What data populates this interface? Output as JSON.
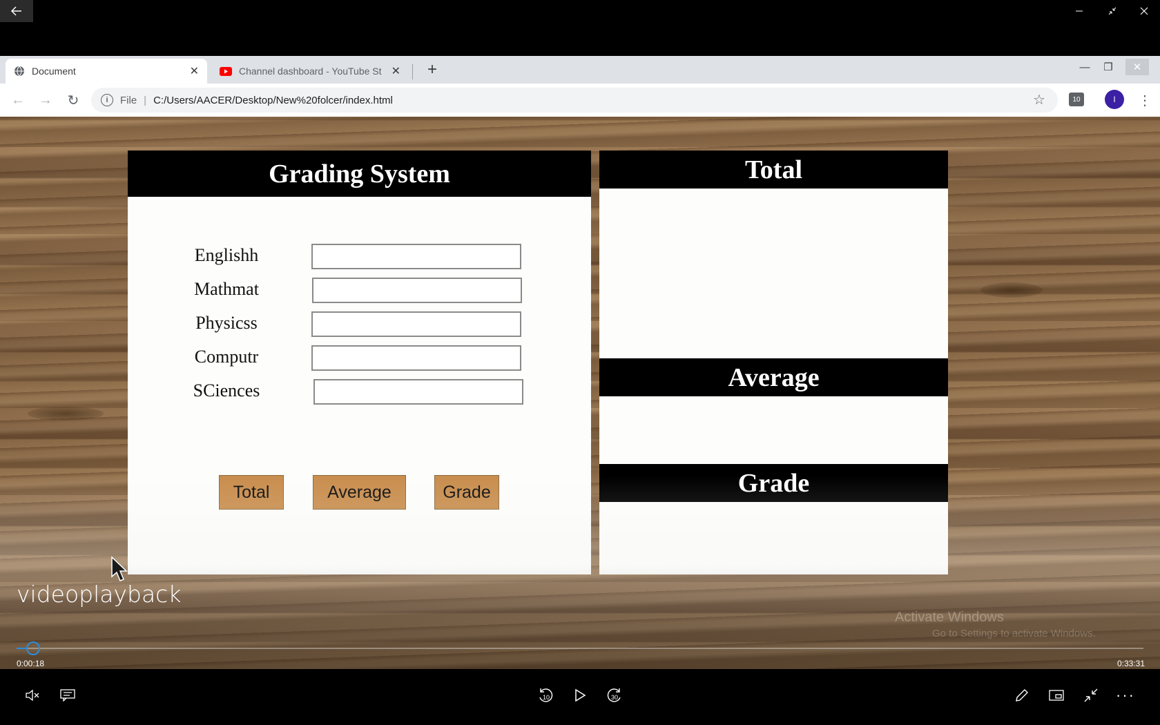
{
  "player": {
    "video_title": "videoplayback",
    "time_current": "0:00:18",
    "time_total": "0:33:31",
    "progress_fraction": 0.009,
    "accent": "#2d8ddb"
  },
  "browser": {
    "tabs": [
      {
        "title": "Document",
        "icon": "globe-icon",
        "active": true
      },
      {
        "title": "Channel dashboard - YouTube St",
        "icon": "youtube-icon",
        "active": false
      }
    ],
    "address": {
      "scheme_label": "File",
      "url": "C:/Users/AACER/Desktop/New%20folcer/index.html"
    },
    "profile_initial": "I"
  },
  "page": {
    "form": {
      "title": "Grading System",
      "fields": [
        {
          "label": "Englishh",
          "value": ""
        },
        {
          "label": "Mathmat",
          "value": ""
        },
        {
          "label": "Physicss",
          "value": ""
        },
        {
          "label": "Computr",
          "value": ""
        },
        {
          "label": "SCiences",
          "value": ""
        }
      ],
      "buttons": {
        "total": "Total",
        "average": "Average",
        "grade": "Grade"
      },
      "button_color": "#c98e4e"
    },
    "results": {
      "total_heading": "Total",
      "average_heading": "Average",
      "grade_heading": "Grade"
    }
  },
  "watermark": {
    "line1": "Activate Windows",
    "line2": "Go to Settings to activate Windows."
  }
}
